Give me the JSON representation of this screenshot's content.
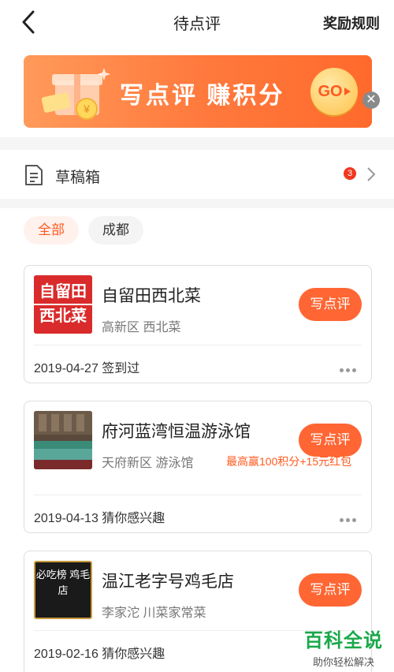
{
  "header": {
    "title": "待点评",
    "rules_label": "奖励规则"
  },
  "banner": {
    "text": "写点评 赚积分",
    "go_label": "GO"
  },
  "drafts": {
    "label": "草稿箱",
    "badge_count": "3"
  },
  "filters": [
    {
      "label": "全部"
    },
    {
      "label": "成都"
    }
  ],
  "cards": [
    {
      "name": "自留田西北菜",
      "sub": "高新区 西北菜",
      "date": "2019-04-27 签到过",
      "button": "写点评",
      "thumb_text": "自留田西北菜"
    },
    {
      "name": "府河蓝湾恒温游泳馆",
      "sub": "天府新区 游泳馆",
      "promo": "最高赢100积分+15元红包",
      "date": "2019-04-13 猜你感兴趣",
      "button": "写点评"
    },
    {
      "name": "温江老字号鸡毛店",
      "sub": "李家沱 川菜家常菜",
      "date": "2019-02-16 猜你感兴趣",
      "button": "写点评",
      "thumb_text": "必吃榜 鸡毛店"
    }
  ],
  "watermark": {
    "main": "百科全说",
    "sub": "助你轻松解决"
  },
  "colors": {
    "accent": "#ff6633",
    "badge": "#f0381f",
    "watermark": "#1aa84a"
  }
}
